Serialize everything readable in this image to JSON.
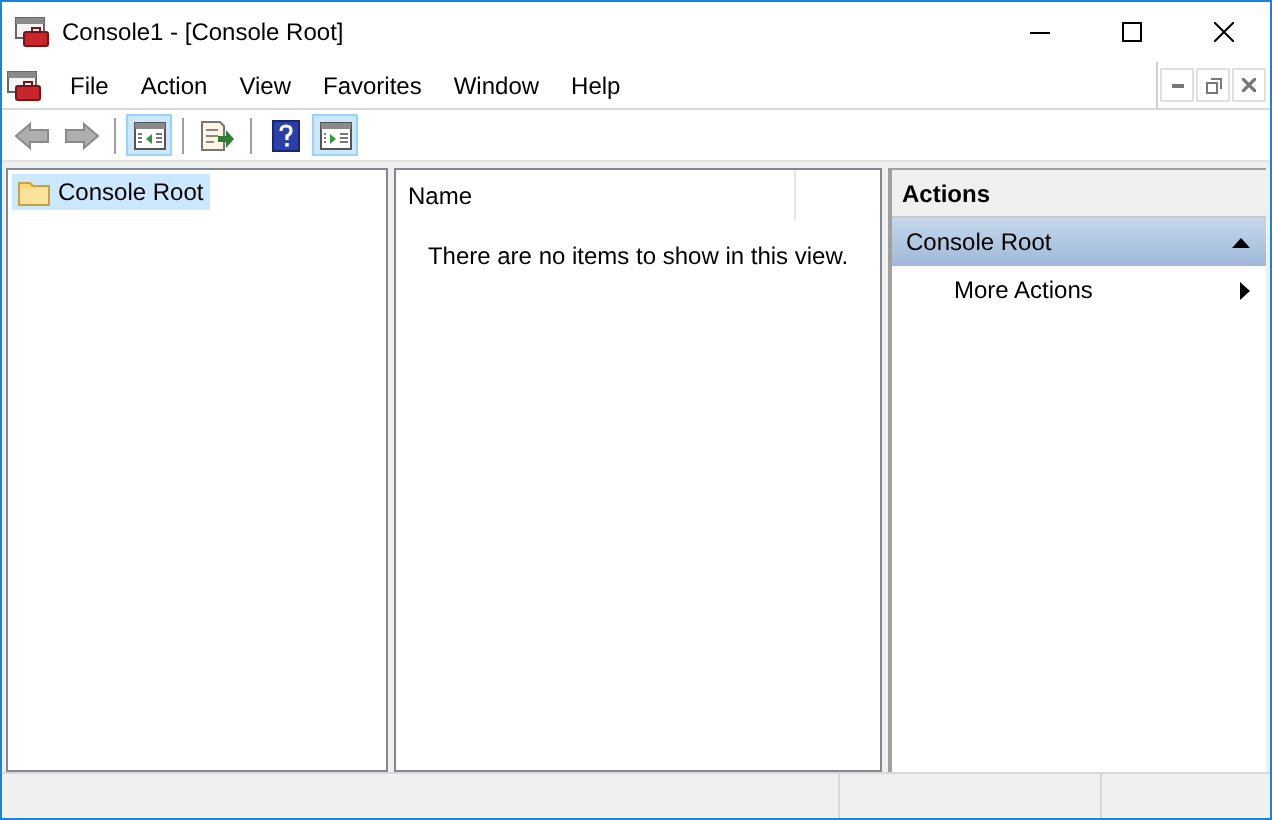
{
  "window": {
    "title": "Console1 - [Console Root]"
  },
  "menu": [
    "File",
    "Action",
    "View",
    "Favorites",
    "Window",
    "Help"
  ],
  "toolbar": [
    {
      "kind": "back",
      "disabled": true,
      "pressed": false
    },
    {
      "kind": "forward",
      "disabled": true,
      "pressed": false
    },
    {
      "kind": "separator"
    },
    {
      "kind": "tree",
      "disabled": false,
      "pressed": true
    },
    {
      "kind": "separator"
    },
    {
      "kind": "export",
      "disabled": false,
      "pressed": false
    },
    {
      "kind": "separator"
    },
    {
      "kind": "help",
      "disabled": false,
      "pressed": false
    },
    {
      "kind": "actions",
      "disabled": false,
      "pressed": true
    }
  ],
  "tree": {
    "items": [
      {
        "label": "Console Root",
        "selected": true
      }
    ]
  },
  "list": {
    "columns": [
      "Name"
    ],
    "empty_message": "There are no items to show in this view."
  },
  "actions": {
    "title": "Actions",
    "sections": [
      {
        "label": "Console Root",
        "expanded": true,
        "items": [
          "More Actions"
        ]
      }
    ]
  }
}
